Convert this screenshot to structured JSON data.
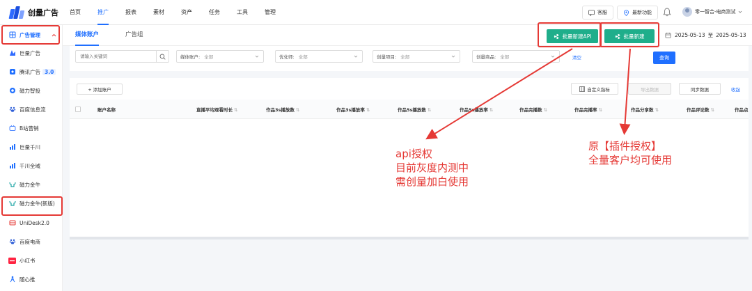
{
  "brand": {
    "name": "创量广告"
  },
  "nav": [
    {
      "label": "首页",
      "active": false
    },
    {
      "label": "推广",
      "active": true
    },
    {
      "label": "报表",
      "active": false
    },
    {
      "label": "素材",
      "active": false
    },
    {
      "label": "资产",
      "active": false
    },
    {
      "label": "任务",
      "active": false
    },
    {
      "label": "工具",
      "active": false
    },
    {
      "label": "管理",
      "active": false
    }
  ],
  "topbar": {
    "service_label": "客服",
    "new_features_label": "最新功能",
    "user_name": "零一智合-电商测试"
  },
  "sidebar": {
    "header": "广告管理",
    "items": [
      {
        "label": "巨量广告",
        "icon": "ocean-engine-icon"
      },
      {
        "label": "腾讯广告",
        "badge": "3.0",
        "icon": "tencent-ads-icon"
      },
      {
        "label": "磁力智投",
        "icon": "kuaishou-icon"
      },
      {
        "label": "百度信息流",
        "icon": "baidu-paw-icon"
      },
      {
        "label": "B站营销",
        "icon": "bilibili-icon"
      },
      {
        "label": "巨量千川",
        "icon": "qianchuan-icon"
      },
      {
        "label": "千川全域",
        "icon": "qianchuan-global-icon"
      },
      {
        "label": "磁力金牛",
        "icon": "jinniu-icon"
      },
      {
        "label": "磁力金牛(新版)",
        "icon": "jinniu-new-icon"
      },
      {
        "label": "UniDesk2.0",
        "icon": "unidesk-icon"
      },
      {
        "label": "百度电商",
        "icon": "baidu-ecom-icon"
      },
      {
        "label": "小红书",
        "icon": "xiaohongshu-icon"
      },
      {
        "label": "随心推",
        "icon": "suixintui-icon"
      }
    ]
  },
  "tabs": [
    {
      "label": "媒体账户",
      "active": true
    },
    {
      "label": "广告组",
      "active": false
    }
  ],
  "actions": {
    "batch_api_label": "批量新建API",
    "batch_label": "批量新建",
    "date_start": "2025-05-13",
    "date_sep": "至",
    "date_end": "2025-05-13"
  },
  "filters": {
    "search_placeholder": "请输入关键词",
    "selects": [
      {
        "label": "媒体账户:",
        "value": "全部"
      },
      {
        "label": "优化师:",
        "value": "全部"
      },
      {
        "label": "创量项目:",
        "value": "全部"
      },
      {
        "label": "创量商品:",
        "value": "全部"
      }
    ],
    "clear_label": "清空",
    "query_label": "查询"
  },
  "table": {
    "add_account_label": "+ 添加账户",
    "custom_metrics_label": "自定义指标",
    "export_label": "导出数据",
    "sync_label": "同步数据",
    "collapse_label": "收起",
    "columns": [
      "账户名称",
      "直播平均观看时长",
      "作品3s播放数",
      "作品3s播放率",
      "作品5s播放数",
      "作品5s播放率",
      "作品完播数",
      "作品完播率",
      "作品分享数",
      "作品评论数",
      "作品点"
    ]
  },
  "annotations": {
    "left_note": [
      "api授权",
      "目前灰度内测中",
      "需创量加白使用"
    ],
    "right_note": [
      "原【插件授权】",
      "全量客户均可使用"
    ]
  },
  "colors": {
    "primary": "#1f6fff",
    "green_button": "#1fae8b",
    "annotation_red": "#e53935"
  }
}
